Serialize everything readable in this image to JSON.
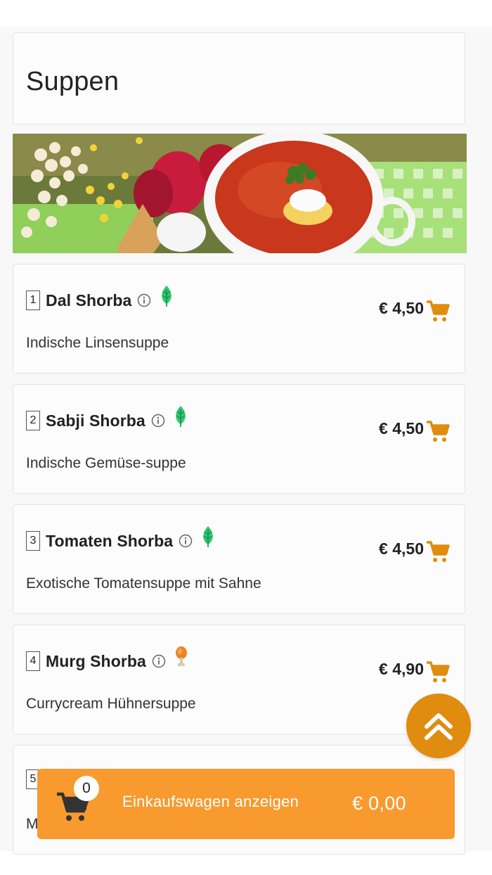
{
  "section": {
    "title": "Suppen"
  },
  "items": [
    {
      "number": "1",
      "name": "Dal Shorba",
      "description": "Indische Linsensuppe",
      "price": "€ 4,50",
      "diet": "leaf-icon"
    },
    {
      "number": "2",
      "name": "Sabji Shorba",
      "description": "Indische Gemüse-suppe",
      "price": "€ 4,50",
      "diet": "leaf-icon"
    },
    {
      "number": "3",
      "name": "Tomaten Shorba",
      "description": "Exotische Tomatensuppe mit Sahne",
      "price": "€ 4,50",
      "diet": "leaf-icon"
    },
    {
      "number": "4",
      "name": "Murg Shorba",
      "description": "Currycream Hühnersuppe",
      "price": "€ 4,90",
      "diet": "chicken-leg-icon"
    }
  ],
  "partial_item": {
    "number": "5",
    "description_fragment": "M"
  },
  "cart_bar": {
    "count": "0",
    "label": "Einkaufswagen anzeigen",
    "total": "€ 0,00"
  },
  "colors": {
    "accent": "#f89a2e",
    "cart_icon": "#e08c0e",
    "leaf": "#2ecc71",
    "scroll_button": "#e08c0e"
  }
}
